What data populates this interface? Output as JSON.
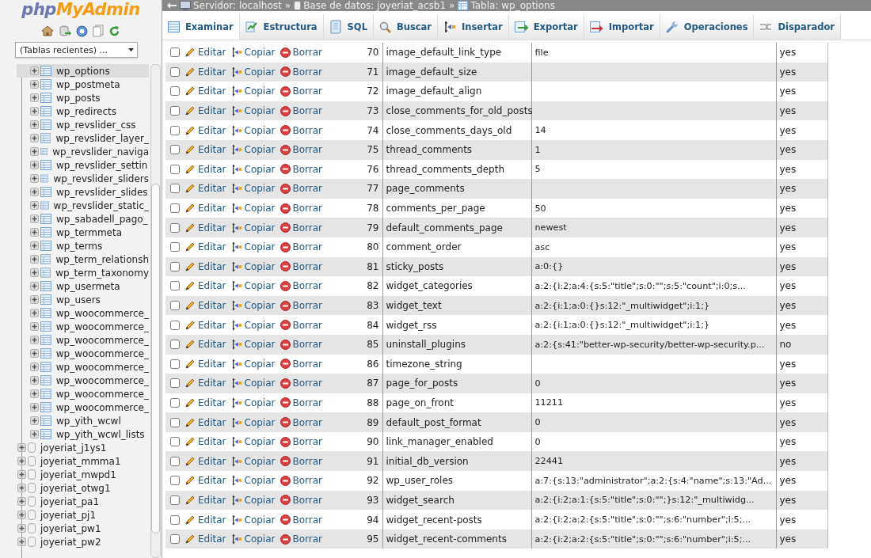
{
  "sidebar": {
    "logo": {
      "php": "php",
      "myadmin": "MyAdmin"
    },
    "recent_tables": {
      "value": "(Tablas recientes) ..."
    },
    "tree": [
      {
        "kind": "table",
        "name": "wp_options",
        "selected": true,
        "expanded": false
      },
      {
        "kind": "table",
        "name": "wp_postmeta",
        "selected": false,
        "expanded": false
      },
      {
        "kind": "table",
        "name": "wp_posts",
        "selected": false,
        "expanded": false
      },
      {
        "kind": "table",
        "name": "wp_redirects",
        "selected": false,
        "expanded": false
      },
      {
        "kind": "table",
        "name": "wp_revslider_css",
        "selected": false,
        "expanded": false
      },
      {
        "kind": "table",
        "name": "wp_revslider_layer_",
        "selected": false,
        "expanded": false
      },
      {
        "kind": "table",
        "name": "wp_revslider_naviga",
        "selected": false,
        "expanded": false
      },
      {
        "kind": "table",
        "name": "wp_revslider_settin",
        "selected": false,
        "expanded": false
      },
      {
        "kind": "table",
        "name": "wp_revslider_sliders",
        "selected": false,
        "expanded": false
      },
      {
        "kind": "table",
        "name": "wp_revslider_slides",
        "selected": false,
        "expanded": false
      },
      {
        "kind": "table",
        "name": "wp_revslider_static_",
        "selected": false,
        "expanded": false
      },
      {
        "kind": "table",
        "name": "wp_sabadell_pago_",
        "selected": false,
        "expanded": false
      },
      {
        "kind": "table",
        "name": "wp_termmeta",
        "selected": false,
        "expanded": false
      },
      {
        "kind": "table",
        "name": "wp_terms",
        "selected": false,
        "expanded": false
      },
      {
        "kind": "table",
        "name": "wp_term_relationsh",
        "selected": false,
        "expanded": false
      },
      {
        "kind": "table",
        "name": "wp_term_taxonomy",
        "selected": false,
        "expanded": false
      },
      {
        "kind": "table",
        "name": "wp_usermeta",
        "selected": false,
        "expanded": false
      },
      {
        "kind": "table",
        "name": "wp_users",
        "selected": false,
        "expanded": false
      },
      {
        "kind": "table",
        "name": "wp_woocommerce_",
        "selected": false,
        "expanded": false
      },
      {
        "kind": "table",
        "name": "wp_woocommerce_",
        "selected": false,
        "expanded": false
      },
      {
        "kind": "table",
        "name": "wp_woocommerce_",
        "selected": false,
        "expanded": false
      },
      {
        "kind": "table",
        "name": "wp_woocommerce_",
        "selected": false,
        "expanded": false
      },
      {
        "kind": "table",
        "name": "wp_woocommerce_",
        "selected": false,
        "expanded": false
      },
      {
        "kind": "table",
        "name": "wp_woocommerce_",
        "selected": false,
        "expanded": false
      },
      {
        "kind": "table",
        "name": "wp_woocommerce_",
        "selected": false,
        "expanded": false
      },
      {
        "kind": "table",
        "name": "wp_woocommerce_",
        "selected": false,
        "expanded": false
      },
      {
        "kind": "table",
        "name": "wp_yith_wcwl",
        "selected": false,
        "expanded": false
      },
      {
        "kind": "table",
        "name": "wp_yith_wcwl_lists",
        "selected": false,
        "expanded": false
      },
      {
        "kind": "database",
        "name": "joyeriat_j1ys1",
        "selected": false,
        "expanded": false
      },
      {
        "kind": "database",
        "name": "joyeriat_mmma1",
        "selected": false,
        "expanded": false
      },
      {
        "kind": "database",
        "name": "joyeriat_mwpd1",
        "selected": false,
        "expanded": false
      },
      {
        "kind": "database",
        "name": "joyeriat_otwg1",
        "selected": false,
        "expanded": false
      },
      {
        "kind": "database",
        "name": "joyeriat_pa1",
        "selected": false,
        "expanded": false
      },
      {
        "kind": "database",
        "name": "joyeriat_pj1",
        "selected": false,
        "expanded": false
      },
      {
        "kind": "database",
        "name": "joyeriat_pw1",
        "selected": false,
        "expanded": false
      },
      {
        "kind": "database",
        "name": "joyeriat_pw2",
        "selected": false,
        "expanded": false
      }
    ]
  },
  "breadcrumb": [
    {
      "kind": "server",
      "label": "Servidor: localhost"
    },
    {
      "kind": "separator",
      "label": "»"
    },
    {
      "kind": "database",
      "label": "Base de datos: joyeriat_acsb1"
    },
    {
      "kind": "separator",
      "label": "»"
    },
    {
      "kind": "table",
      "label": "Tabla: wp_options"
    }
  ],
  "tabs": [
    {
      "kind": "browse",
      "label": "Examinar",
      "selected": true
    },
    {
      "kind": "structure",
      "label": "Estructura",
      "selected": false
    },
    {
      "kind": "sql",
      "label": "SQL",
      "selected": false
    },
    {
      "kind": "search",
      "label": "Buscar",
      "selected": false
    },
    {
      "kind": "insert",
      "label": "Insertar",
      "selected": false
    },
    {
      "kind": "export",
      "label": "Exportar",
      "selected": false
    },
    {
      "kind": "import",
      "label": "Importar",
      "selected": false
    },
    {
      "kind": "operations",
      "label": "Operaciones",
      "selected": false
    },
    {
      "kind": "triggers",
      "label": "Disparador",
      "selected": false
    }
  ],
  "table": {
    "rows": [
      {
        "checked": false,
        "edit": "Editar",
        "copy": "Copiar",
        "delete": "Borrar",
        "id": "70",
        "name": "image_default_link_type",
        "value": "file",
        "autoload": "yes"
      },
      {
        "checked": false,
        "edit": "Editar",
        "copy": "Copiar",
        "delete": "Borrar",
        "id": "71",
        "name": "image_default_size",
        "autoload": "yes"
      },
      {
        "checked": false,
        "edit": "Editar",
        "copy": "Copiar",
        "delete": "Borrar",
        "id": "72",
        "name": "image_default_align",
        "autoload": "yes"
      },
      {
        "checked": false,
        "edit": "Editar",
        "copy": "Copiar",
        "delete": "Borrar",
        "id": "73",
        "name": "close_comments_for_old_posts",
        "autoload": "yes"
      },
      {
        "checked": false,
        "edit": "Editar",
        "copy": "Copiar",
        "delete": "Borrar",
        "id": "74",
        "name": "close_comments_days_old",
        "value": "14",
        "autoload": "yes"
      },
      {
        "checked": false,
        "edit": "Editar",
        "copy": "Copiar",
        "delete": "Borrar",
        "id": "75",
        "name": "thread_comments",
        "value": "1",
        "autoload": "yes"
      },
      {
        "checked": false,
        "edit": "Editar",
        "copy": "Copiar",
        "delete": "Borrar",
        "id": "76",
        "name": "thread_comments_depth",
        "value": "5",
        "autoload": "yes"
      },
      {
        "checked": false,
        "edit": "Editar",
        "copy": "Copiar",
        "delete": "Borrar",
        "id": "77",
        "name": "page_comments",
        "autoload": "yes"
      },
      {
        "checked": false,
        "edit": "Editar",
        "copy": "Copiar",
        "delete": "Borrar",
        "id": "78",
        "name": "comments_per_page",
        "value": "50",
        "autoload": "yes"
      },
      {
        "checked": false,
        "edit": "Editar",
        "copy": "Copiar",
        "delete": "Borrar",
        "id": "79",
        "name": "default_comments_page",
        "value": "newest",
        "autoload": "yes"
      },
      {
        "checked": false,
        "edit": "Editar",
        "copy": "Copiar",
        "delete": "Borrar",
        "id": "80",
        "name": "comment_order",
        "value": "asc",
        "autoload": "yes"
      },
      {
        "checked": false,
        "edit": "Editar",
        "copy": "Copiar",
        "delete": "Borrar",
        "id": "81",
        "name": "sticky_posts",
        "value": "a:0:{}",
        "autoload": "yes"
      },
      {
        "checked": false,
        "edit": "Editar",
        "copy": "Copiar",
        "delete": "Borrar",
        "id": "82",
        "name": "widget_categories",
        "value": "a:2:{i:2;a:4:{s:5:\"title\";s:0:\"\";s:5:\"count\";i:0;s...",
        "autoload": "yes"
      },
      {
        "checked": false,
        "edit": "Editar",
        "copy": "Copiar",
        "delete": "Borrar",
        "id": "83",
        "name": "widget_text",
        "value": "a:2:{i:1;a:0:{}s:12:\"_multiwidget\";i:1;}",
        "autoload": "yes"
      },
      {
        "checked": false,
        "edit": "Editar",
        "copy": "Copiar",
        "delete": "Borrar",
        "id": "84",
        "name": "widget_rss",
        "value": "a:2:{i:1;a:0:{}s:12:\"_multiwidget\";i:1;}",
        "autoload": "yes"
      },
      {
        "checked": false,
        "edit": "Editar",
        "copy": "Copiar",
        "delete": "Borrar",
        "id": "85",
        "name": "uninstall_plugins",
        "value": "a:2:{s:41:\"better-wp-security/better-wp-security.p...",
        "autoload": "no"
      },
      {
        "checked": false,
        "edit": "Editar",
        "copy": "Copiar",
        "delete": "Borrar",
        "id": "86",
        "name": "timezone_string",
        "autoload": "yes"
      },
      {
        "checked": false,
        "edit": "Editar",
        "copy": "Copiar",
        "delete": "Borrar",
        "id": "87",
        "name": "page_for_posts",
        "value": "0",
        "autoload": "yes"
      },
      {
        "checked": false,
        "edit": "Editar",
        "copy": "Copiar",
        "delete": "Borrar",
        "id": "88",
        "name": "page_on_front",
        "value": "11211",
        "autoload": "yes"
      },
      {
        "checked": false,
        "edit": "Editar",
        "copy": "Copiar",
        "delete": "Borrar",
        "id": "89",
        "name": "default_post_format",
        "value": "0",
        "autoload": "yes"
      },
      {
        "checked": false,
        "edit": "Editar",
        "copy": "Copiar",
        "delete": "Borrar",
        "id": "90",
        "name": "link_manager_enabled",
        "value": "0",
        "autoload": "yes"
      },
      {
        "checked": false,
        "edit": "Editar",
        "copy": "Copiar",
        "delete": "Borrar",
        "id": "91",
        "name": "initial_db_version",
        "value": "22441",
        "autoload": "yes"
      },
      {
        "checked": false,
        "edit": "Editar",
        "copy": "Copiar",
        "delete": "Borrar",
        "id": "92",
        "name": "wp_user_roles",
        "value": "a:7:{s:13:\"administrator\";a:2:{s:4:\"name\";s:13:\"Ad...",
        "autoload": "yes"
      },
      {
        "checked": false,
        "edit": "Editar",
        "copy": "Copiar",
        "delete": "Borrar",
        "id": "93",
        "name": "widget_search",
        "value": "a:2:{i:2;a:1:{s:5:\"title\";s:0:\"\";}s:12:\"_multiwidg...",
        "autoload": "yes"
      },
      {
        "checked": false,
        "edit": "Editar",
        "copy": "Copiar",
        "delete": "Borrar",
        "id": "94",
        "name": "widget_recent-posts",
        "value": "a:2:{i:2;a:2:{s:5:\"title\";s:0:\"\";s:6:\"number\";i:5;...",
        "autoload": "yes"
      },
      {
        "checked": false,
        "edit": "Editar",
        "copy": "Copiar",
        "delete": "Borrar",
        "id": "95",
        "name": "widget_recent-comments",
        "value": "a:2:{i:2;a:2:{s:5:\"title\";s:0:\"\";s:6:\"number\";i:5;...",
        "autoload": "yes"
      }
    ]
  }
}
